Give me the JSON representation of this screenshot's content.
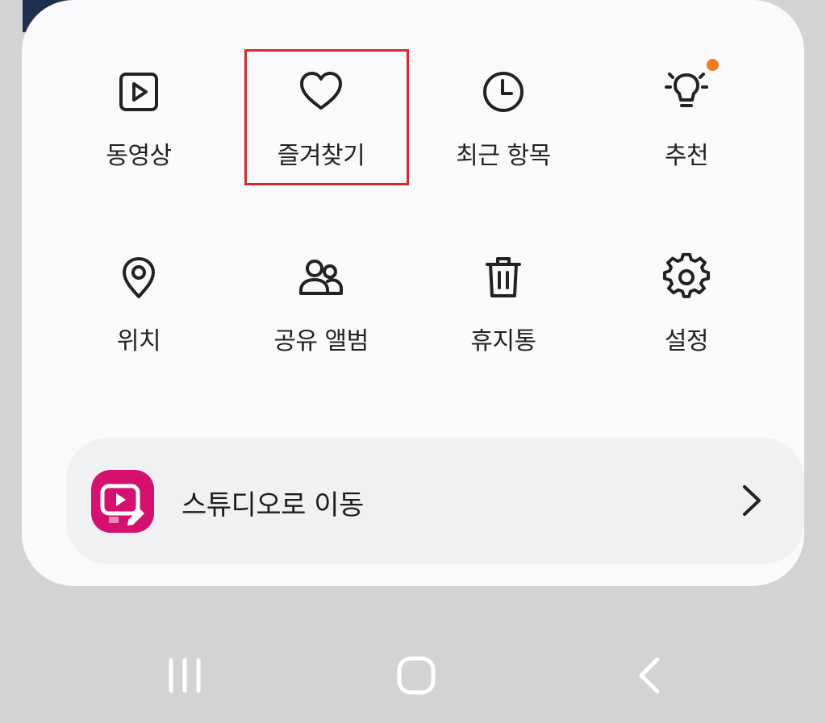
{
  "menu": {
    "items": [
      {
        "label": "동영상",
        "icon": "video-icon"
      },
      {
        "label": "즐겨찾기",
        "icon": "heart-icon"
      },
      {
        "label": "최근 항목",
        "icon": "clock-icon"
      },
      {
        "label": "추천",
        "icon": "lightbulb-icon"
      },
      {
        "label": "위치",
        "icon": "location-pin-icon"
      },
      {
        "label": "공유 앨범",
        "icon": "people-icon"
      },
      {
        "label": "휴지통",
        "icon": "trash-icon"
      },
      {
        "label": "설정",
        "icon": "gear-icon"
      }
    ],
    "highlighted_item": "즐겨찾기",
    "notification_dot_color": "#f07a1e",
    "highlight_color": "#d62b2b"
  },
  "studio": {
    "label": "스튜디오로 이동",
    "icon": "studio-app-icon",
    "accent": "#d5106f"
  },
  "navbar": {
    "buttons": [
      "recent-apps",
      "home",
      "back"
    ]
  }
}
